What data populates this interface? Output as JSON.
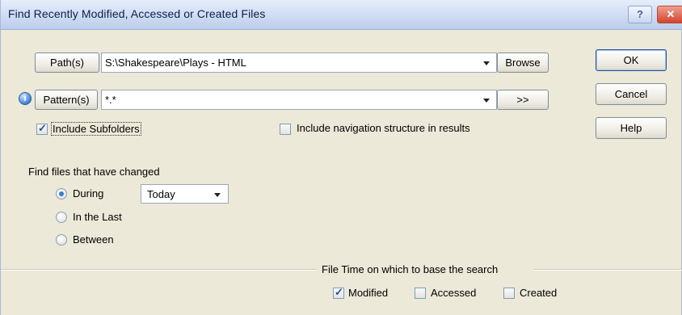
{
  "window": {
    "title": "Find Recently Modified, Accessed or Created Files"
  },
  "titlebar": {
    "help_glyph": "?",
    "close_glyph": "✕"
  },
  "path": {
    "button_label": "Path(s)",
    "value": "S:\\Shakespeare\\Plays - HTML",
    "browse_label": "Browse"
  },
  "pattern": {
    "button_label": "Pattern(s)",
    "value": "*.*",
    "more_label": ">>",
    "info_glyph": "i"
  },
  "options": {
    "include_subfolders": {
      "label": "Include Subfolders",
      "checked": true
    },
    "include_navigation": {
      "label": "Include navigation structure in results",
      "checked": false
    }
  },
  "actions": {
    "ok_label": "OK",
    "cancel_label": "Cancel",
    "help_label": "Help"
  },
  "changed": {
    "heading": "Find files that have changed",
    "options": [
      {
        "label": "During",
        "selected": true
      },
      {
        "label": "In the Last",
        "selected": false
      },
      {
        "label": "Between",
        "selected": false
      }
    ],
    "during_value": "Today"
  },
  "filetime": {
    "heading": "File Time on which to base the search",
    "options": [
      {
        "label": "Modified",
        "checked": true
      },
      {
        "label": "Accessed",
        "checked": false
      },
      {
        "label": "Created",
        "checked": false
      }
    ]
  },
  "check_glyph": "✓"
}
